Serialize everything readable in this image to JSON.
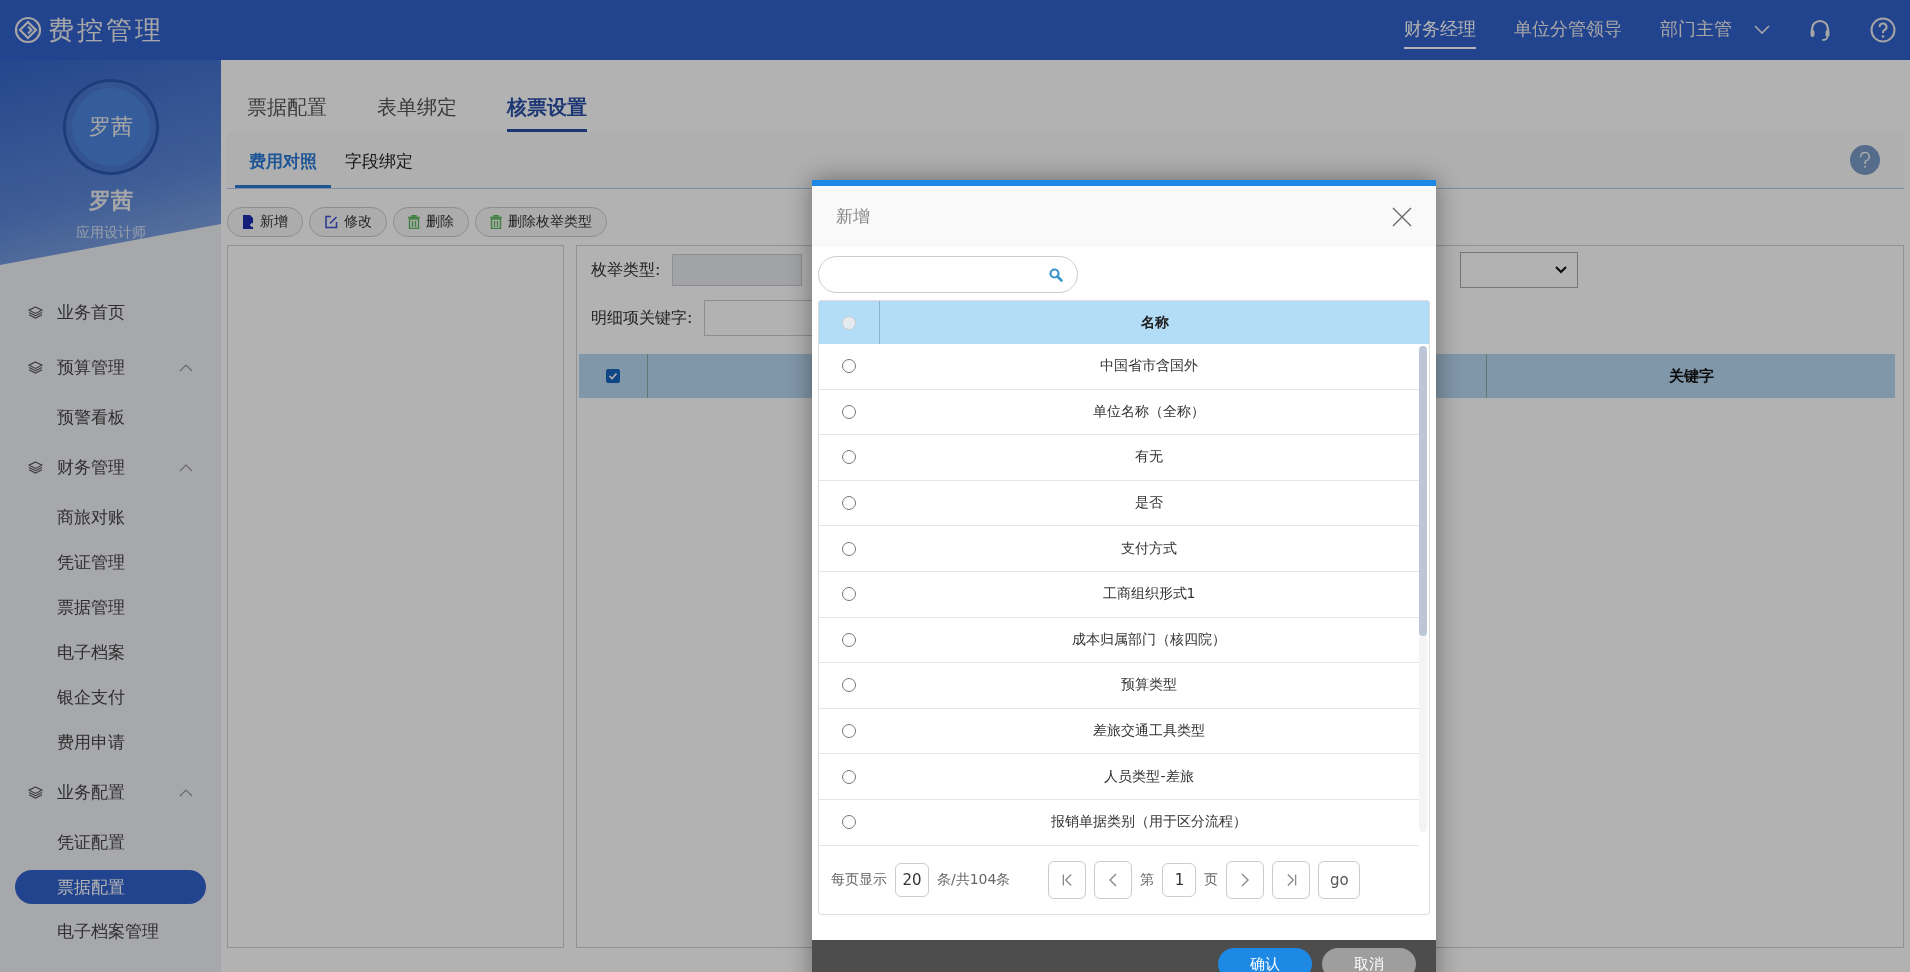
{
  "app": {
    "title": "费控管理"
  },
  "roles": [
    {
      "label": "财务经理",
      "selected": true
    },
    {
      "label": "单位分管领导",
      "selected": false
    },
    {
      "label": "部门主管",
      "selected": false
    }
  ],
  "user": {
    "avatar_text": "罗茜",
    "name": "罗茜",
    "role": "应用设计师"
  },
  "sidebar": {
    "items": [
      {
        "label": "业务首页",
        "selected": false
      },
      {
        "label": "预算管理",
        "expanded": true,
        "children": [
          {
            "label": "预警看板",
            "selected": false
          }
        ]
      },
      {
        "label": "财务管理",
        "expanded": true,
        "children": [
          {
            "label": "商旅对账",
            "selected": false
          },
          {
            "label": "凭证管理",
            "selected": false
          },
          {
            "label": "票据管理",
            "selected": false
          },
          {
            "label": "电子档案",
            "selected": false
          },
          {
            "label": "银企支付",
            "selected": false
          },
          {
            "label": "费用申请",
            "selected": false
          }
        ]
      },
      {
        "label": "业务配置",
        "expanded": true,
        "children": [
          {
            "label": "凭证配置",
            "selected": false
          },
          {
            "label": "票据配置",
            "selected": true
          },
          {
            "label": "电子档案管理",
            "selected": false
          }
        ]
      }
    ]
  },
  "tabs": [
    {
      "label": "票据配置",
      "selected": false
    },
    {
      "label": "表单绑定",
      "selected": false
    },
    {
      "label": "核票设置",
      "selected": true
    }
  ],
  "subtabs": [
    {
      "label": "费用对照",
      "selected": true
    },
    {
      "label": "字段绑定",
      "selected": false
    }
  ],
  "toolbar": [
    {
      "label": "新增",
      "kind": "new"
    },
    {
      "label": "修改",
      "kind": "edit"
    },
    {
      "label": "删除",
      "kind": "delete"
    },
    {
      "label": "删除枚举类型",
      "kind": "delete"
    }
  ],
  "form": {
    "enum_type_label": "枚举类型:",
    "keyword_label": "明细项关键字:"
  },
  "grid": {
    "select_all_checked": true,
    "keyword_column": "关键字"
  },
  "dialog": {
    "title": "新增",
    "column": "名称",
    "header_radio_disabled": true,
    "rows": [
      {
        "name": "中国省市含国外",
        "selected": false
      },
      {
        "name": "单位名称（全称）",
        "selected": false
      },
      {
        "name": "有无",
        "selected": false
      },
      {
        "name": "是否",
        "selected": false
      },
      {
        "name": "支付方式",
        "selected": false
      },
      {
        "name": "工商组织形式1",
        "selected": false
      },
      {
        "name": "成本归属部门（核四院）",
        "selected": false
      },
      {
        "name": "预算类型",
        "selected": false
      },
      {
        "name": "差旅交通工具类型",
        "selected": false
      },
      {
        "name": "人员类型-差旅",
        "selected": false
      },
      {
        "name": "报销单据类别（用于区分流程）",
        "selected": false
      }
    ],
    "pagination": {
      "per_page_label": "每页显示",
      "page_size": "20",
      "total_label": "条/共104条",
      "page_prefix": "第",
      "page": "1",
      "page_suffix": "页",
      "go": "go"
    },
    "buttons": [
      {
        "label": "确认",
        "kind": "primary"
      },
      {
        "label": "取消",
        "kind": "secondary"
      }
    ]
  }
}
